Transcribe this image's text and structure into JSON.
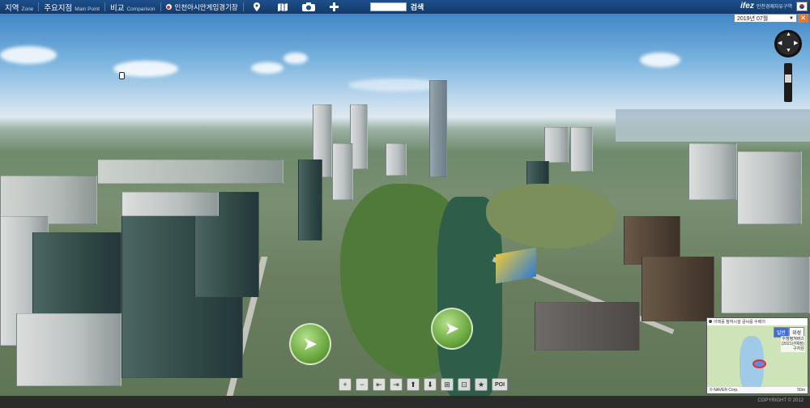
{
  "topbar": {
    "nav": [
      {
        "ko": "지역",
        "en": "Zone"
      },
      {
        "ko": "주요지점",
        "en": "Main Point"
      },
      {
        "ko": "비교",
        "en": "Comparison"
      }
    ],
    "expo_label": "인천아시안게임경기장",
    "icons": [
      "map-pin-icon",
      "book-map-icon",
      "camera-icon",
      "plus-icon"
    ],
    "search_placeholder": "",
    "search_label": "검색",
    "brand_logo": "ifez",
    "brand_sub": "인천경제자유구역"
  },
  "date_select": {
    "value": "2019년 07월"
  },
  "minimap": {
    "header": "아래를 참여시설 글씨를 수배의",
    "toggle": [
      "일반",
      "위성"
    ],
    "label_line1": "수정평쳐버스",
    "label_line2": "(2021년예정)",
    "label_line3": "구자원",
    "footer_left": "© NAVER Corp.",
    "footer_right": "50m"
  },
  "toolbar": {
    "tools": [
      "+",
      "−",
      "⇤",
      "⇥",
      "⬆",
      "⬇",
      "⊞",
      "⊡",
      "★"
    ],
    "poi_label": "POI"
  },
  "copyright": "COPYRIGHT © 2012"
}
